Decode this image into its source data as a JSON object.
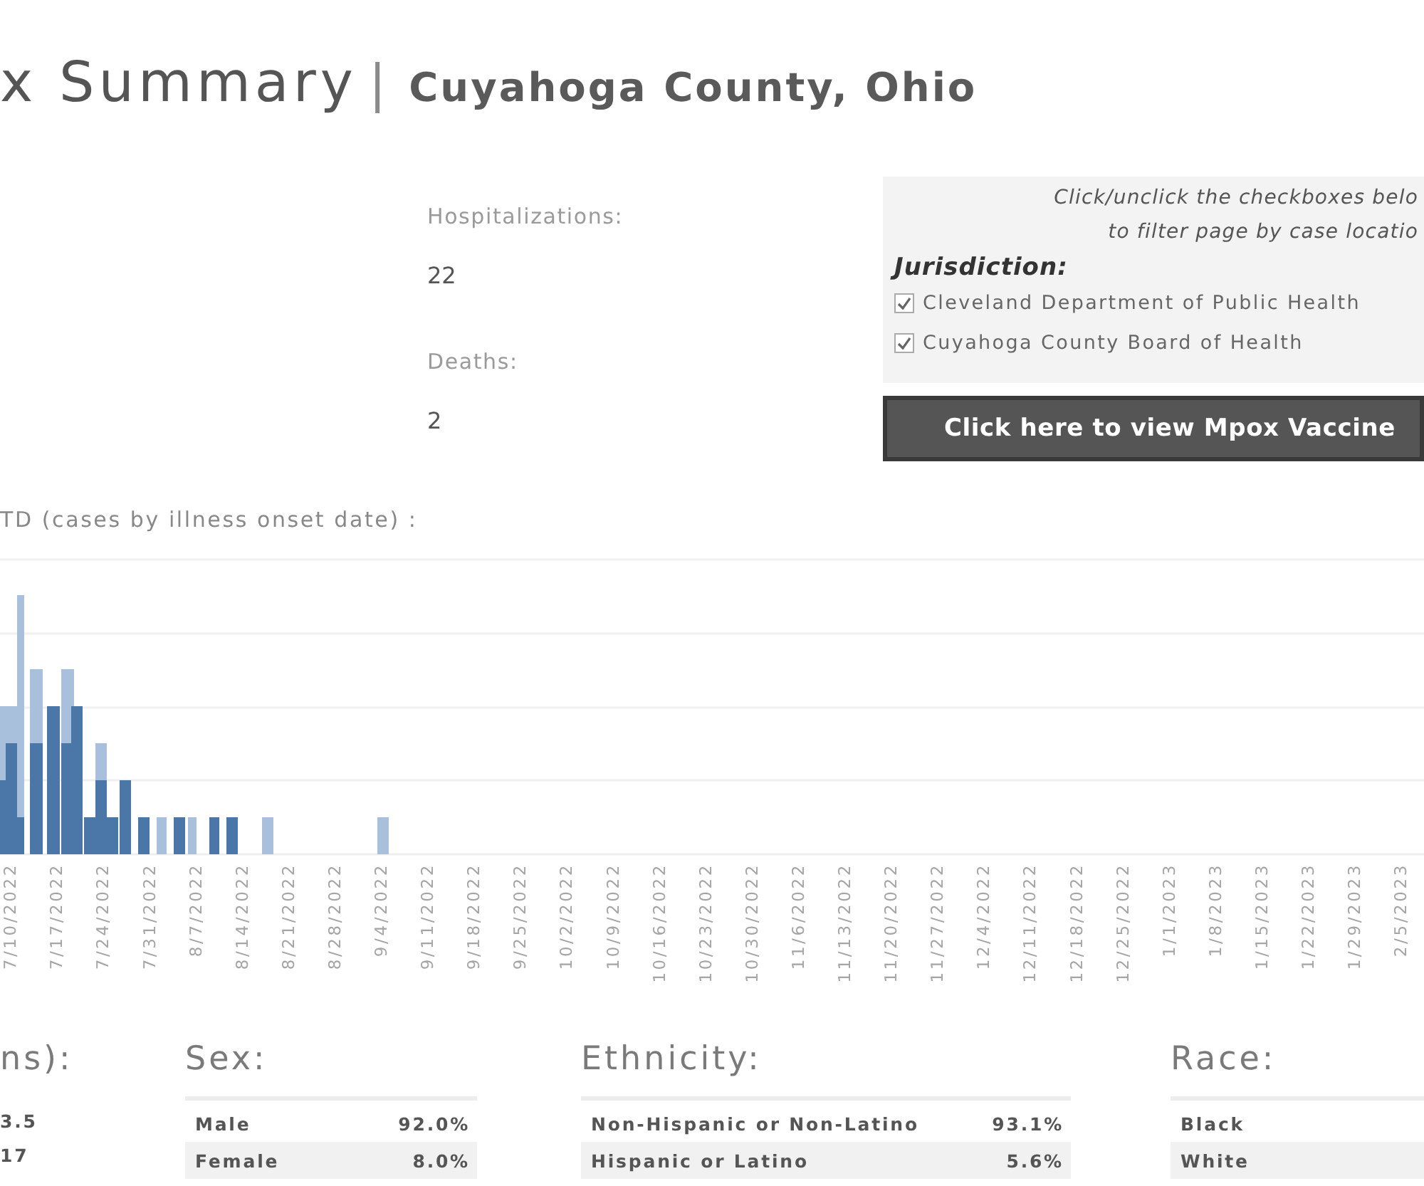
{
  "header": {
    "title": "x Summary",
    "separator": "|",
    "subtitle": "Cuyahoga County, Ohio"
  },
  "stats": [
    {
      "label": "Hospitalizations:",
      "value": "22"
    },
    {
      "label": "Deaths:",
      "value": "2"
    }
  ],
  "filter_panel": {
    "instructions": [
      "Click/unclick the checkboxes belo",
      "to filter page by case locatio"
    ],
    "heading": "Jurisdiction:",
    "options": [
      {
        "label": "Cleveland Department of Public Health",
        "checked": true
      },
      {
        "label": "Cuyahoga County Board of Health",
        "checked": true
      }
    ],
    "button": "Click here to view Mpox Vaccine"
  },
  "chart": {
    "title": "TD (cases by illness onset date) :",
    "x_labels": [
      "7/10/2022",
      "7/17/2022",
      "7/24/2022",
      "7/31/2022",
      "8/7/2022",
      "8/14/2022",
      "8/21/2022",
      "8/28/2022",
      "9/4/2022",
      "9/11/2022",
      "9/18/2022",
      "9/25/2022",
      "10/2/2022",
      "10/9/2022",
      "10/16/2022",
      "10/23/2022",
      "10/30/2022",
      "11/6/2022",
      "11/13/2022",
      "11/20/2022",
      "11/27/2022",
      "12/4/2022",
      "12/11/2022",
      "12/18/2022",
      "12/25/2022",
      "1/1/2023",
      "1/8/2023",
      "1/15/2023",
      "1/22/2023",
      "1/29/2023",
      "2/5/2023"
    ]
  },
  "breakdowns": [
    {
      "heading": "ns):",
      "kind": "plain",
      "rows": [
        {
          "value": "3.5"
        },
        {
          "value": "17"
        }
      ]
    },
    {
      "heading": "Sex:",
      "kind": "table",
      "rows": [
        {
          "label": "Male",
          "value": "92.0%"
        },
        {
          "label": "Female",
          "value": "8.0%"
        }
      ]
    },
    {
      "heading": "Ethnicity:",
      "kind": "table",
      "rows": [
        {
          "label": "Non-Hispanic or Non-Latino",
          "value": "93.1%"
        },
        {
          "label": "Hispanic or Latino",
          "value": "5.6%"
        }
      ]
    },
    {
      "heading": "Race:",
      "kind": "table",
      "rows": [
        {
          "label": "Black"
        },
        {
          "label": "White"
        }
      ]
    }
  ]
}
